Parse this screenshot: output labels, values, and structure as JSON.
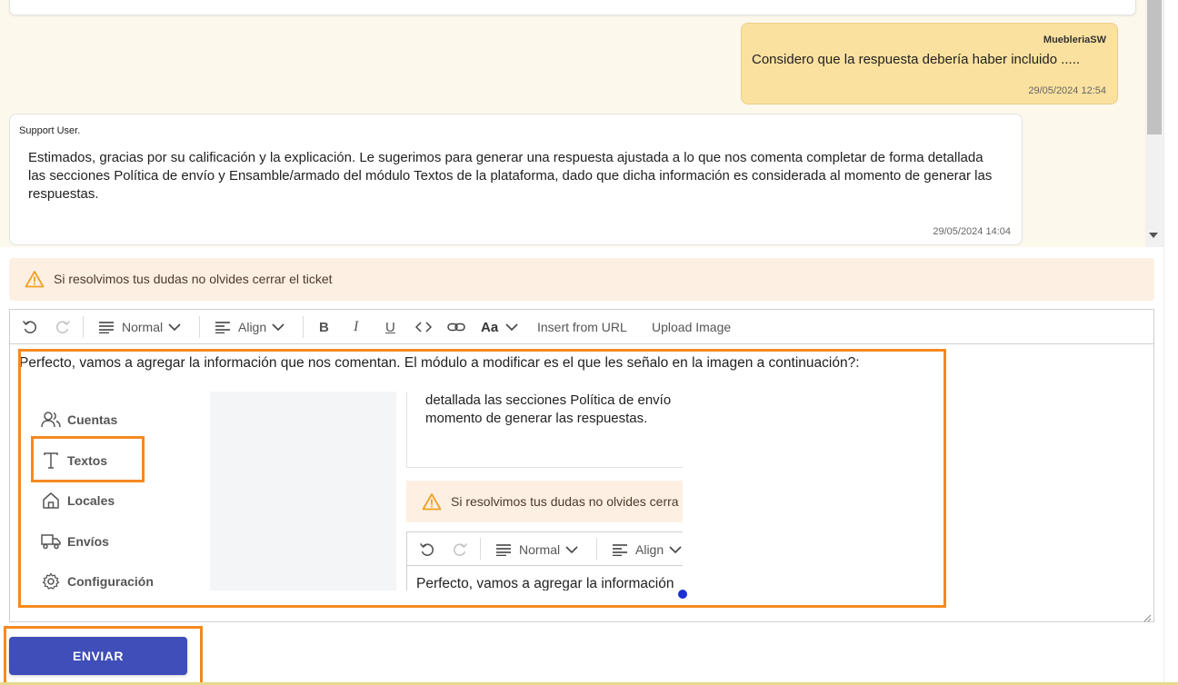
{
  "chat": {
    "user_message": {
      "author": "MuebleriaSW",
      "text": "Considero que la respuesta debería haber incluido .....",
      "time": "29/05/2024 12:54"
    },
    "support_message": {
      "author": "Support User.",
      "text": "Estimados, gracias por su calificación y la explicación. Le sugerimos para generar una respuesta ajustada a lo que nos comenta completar de forma detallada las secciones Política de envío y Ensamble/armado del módulo Textos de la plataforma, dado que dicha información es considerada al momento de generar las respuestas.",
      "time": "29/05/2024 14:04"
    }
  },
  "alert": {
    "text": "Si resolvimos tus dudas no olvides cerrar el ticket"
  },
  "toolbar": {
    "paragraph_style": "Normal",
    "align_label": "Align",
    "font_label": "Aa",
    "insert_url": "Insert from URL",
    "upload_image": "Upload Image"
  },
  "editor": {
    "text": "Perfecto, vamos a agregar la información que nos comentan. El módulo a modificar es el que les señalo en la imagen a continuación?:"
  },
  "embedded_screenshot": {
    "nav_items": [
      "Cuentas",
      "Textos",
      "Locales",
      "Envíos",
      "Configuración"
    ],
    "card_line1": "detallada las secciones Política de envío",
    "card_line2": "momento de generar las respuestas.",
    "alert_text": "Si resolvimos tus dudas no olvides cerra",
    "toolbar_style": "Normal",
    "toolbar_align": "Align",
    "editor_text": "Perfecto, vamos a agregar la información"
  },
  "send_button": "ENVIAR",
  "colors": {
    "accent": "#3f4eb8",
    "user_bubble": "#fae19f",
    "highlight": "#f5891f",
    "alert_bg": "#fdf0e3",
    "warning": "#f0a020"
  }
}
